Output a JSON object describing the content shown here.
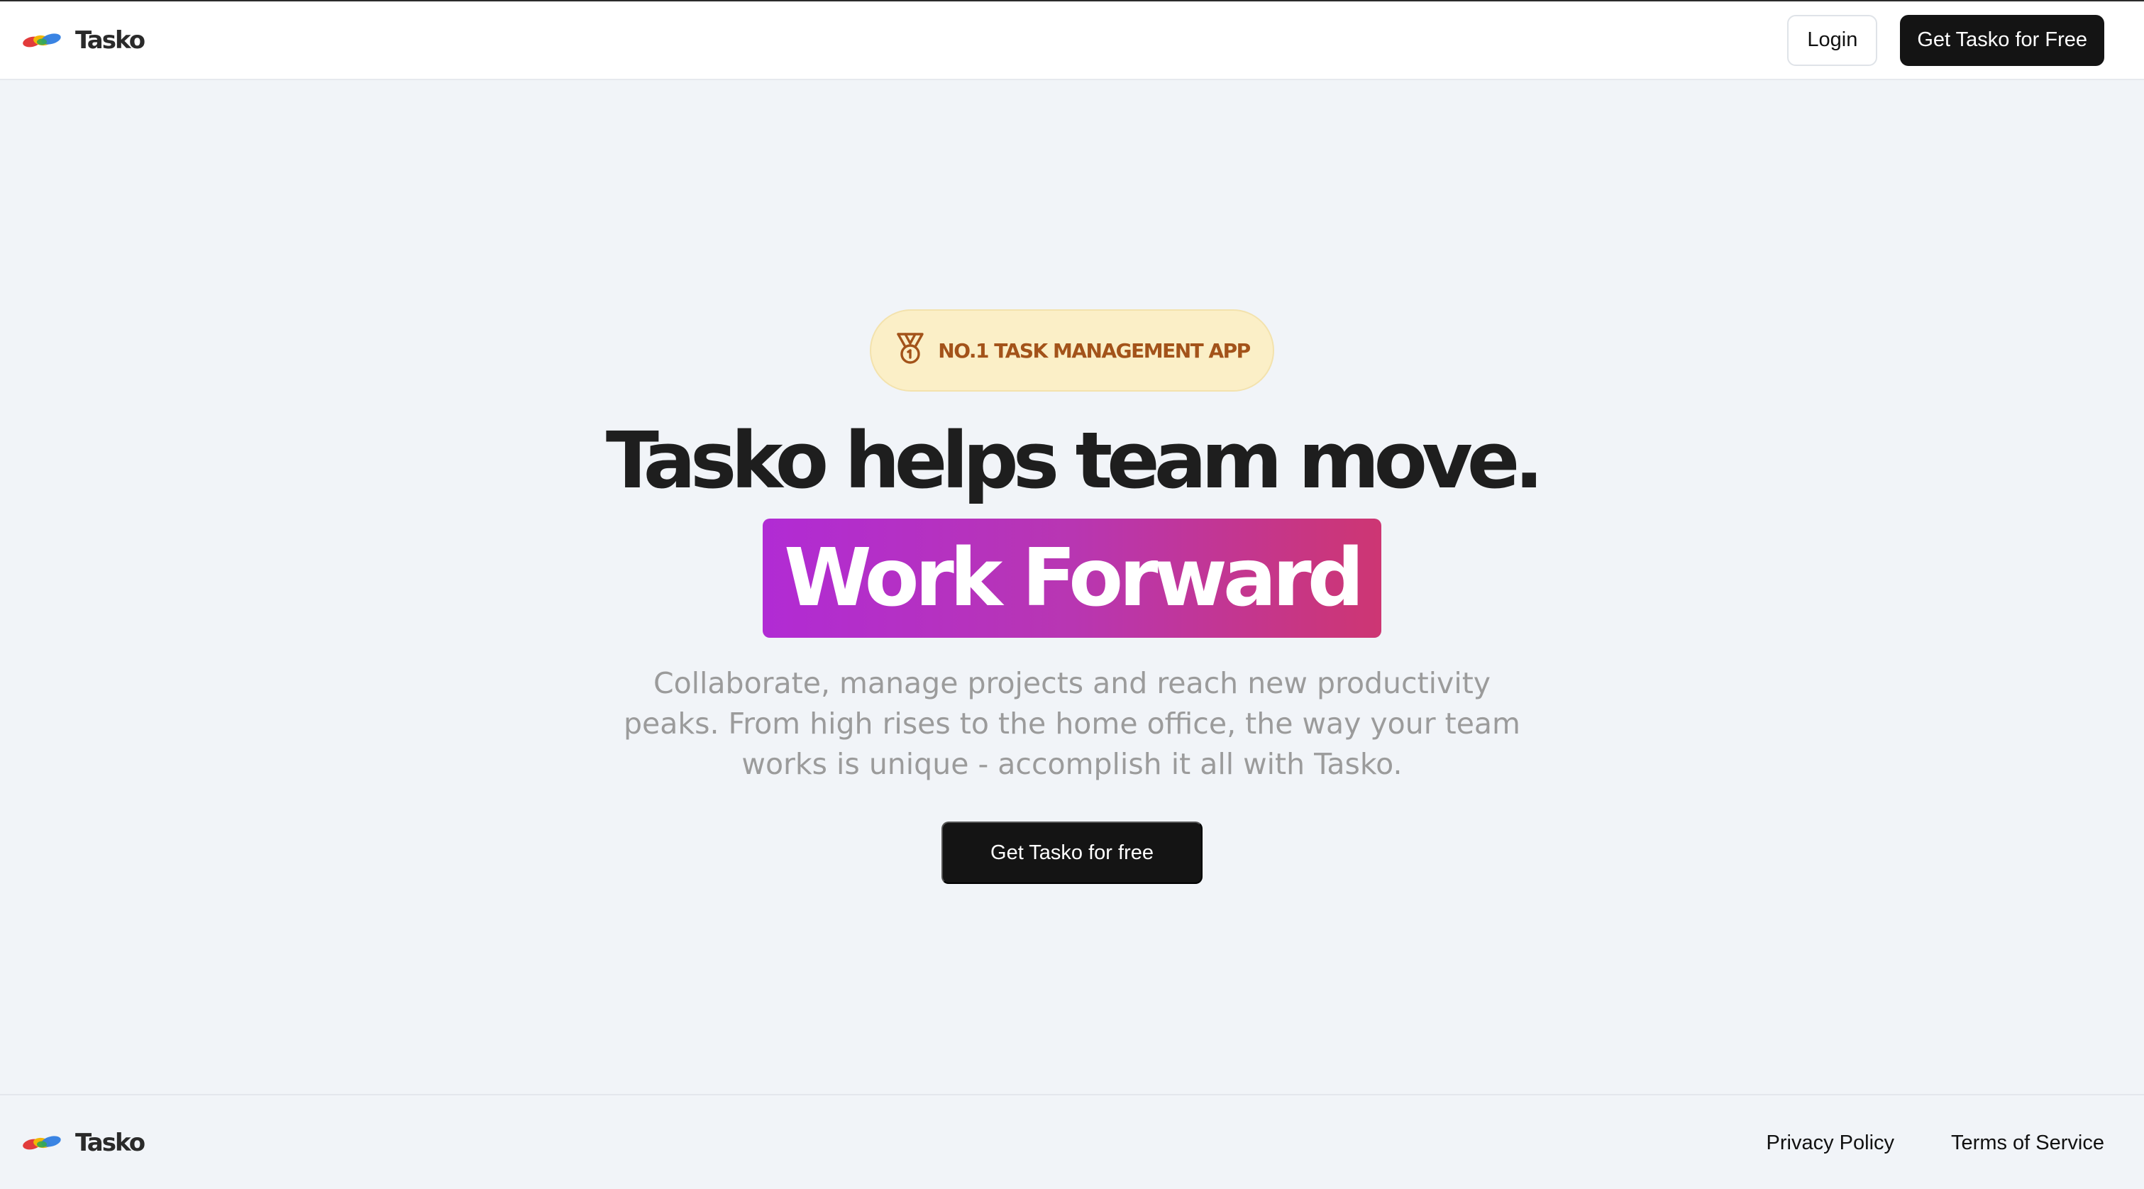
{
  "header": {
    "brand_name": "Tasko",
    "login_label": "Login",
    "cta_label": "Get Tasko for Free"
  },
  "hero": {
    "badge_icon": "medal-icon",
    "badge_text": "NO.1 TASK MANAGEMENT APP",
    "headline": "Tasko helps team move.",
    "highlight": "Work Forward",
    "subtext": "Collaborate, manage projects and reach new productivity peaks. From high rises to the home office, the way your team works is unique - accomplish it all with Tasko.",
    "cta_label": "Get Tasko for free"
  },
  "footer": {
    "brand_name": "Tasko",
    "links": [
      "Privacy Policy",
      "Terms of Service"
    ]
  },
  "colors": {
    "page_background": "#f1f4f8",
    "primary_button": "#141414",
    "badge_background": "#fbefc7",
    "badge_text": "#a3531a",
    "highlight_gradient_start": "#b12bd4",
    "highlight_gradient_end": "#cd3673",
    "subtext": "#9b9b9b"
  }
}
